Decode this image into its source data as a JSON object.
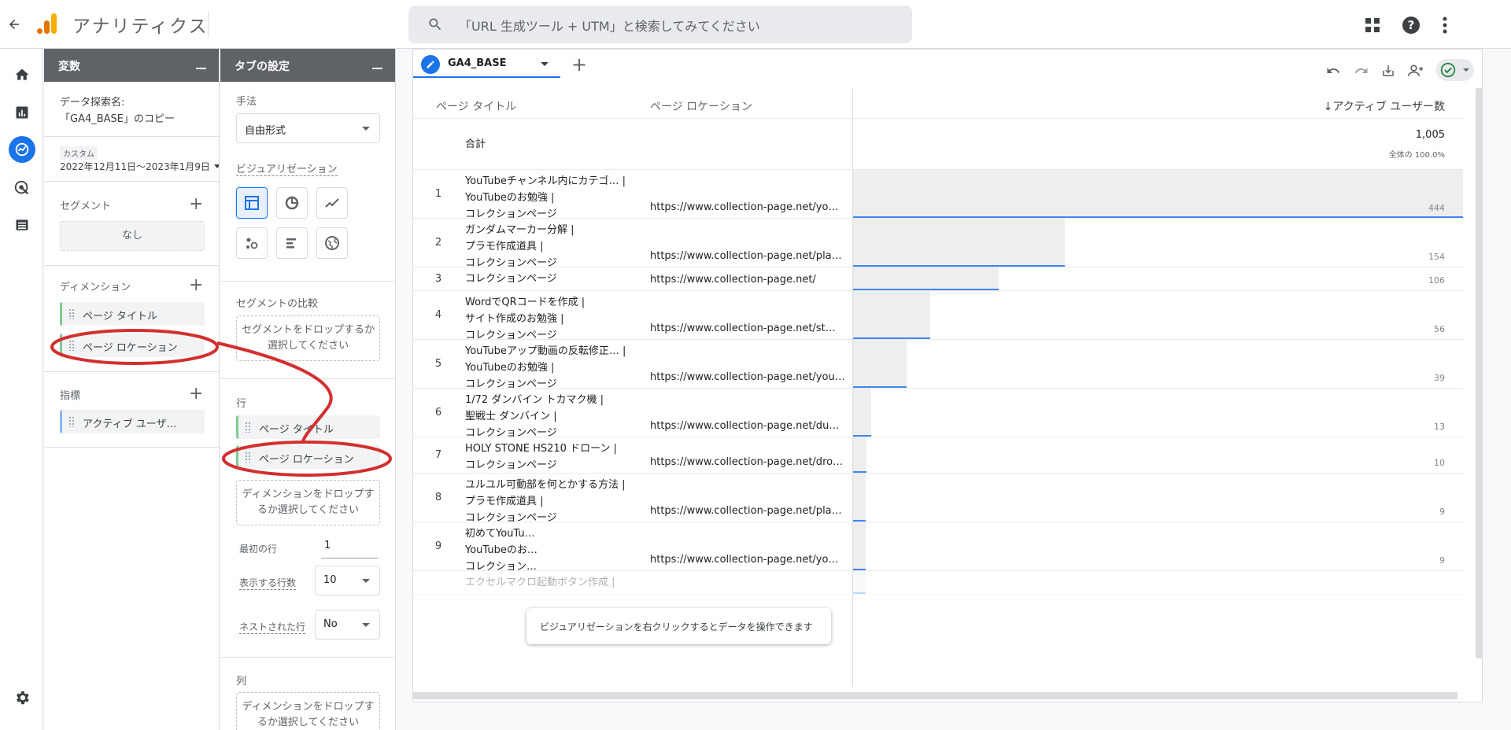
{
  "header": {
    "back_icon": "arrow-left-icon",
    "logo_icon": "analytics-logo-icon",
    "app_title": "アナリティクス",
    "search_placeholder": "「URL 生成ツール + UTM」と検索してみてください",
    "apps_icon": "apps-grid-icon",
    "help_icon": "help-icon",
    "more_icon": "more-vert-icon"
  },
  "nav": {
    "items": [
      "home-icon",
      "reports-icon",
      "explore-icon",
      "advertising-icon",
      "configure-icon"
    ],
    "settings_icon": "gear-icon"
  },
  "variables_panel": {
    "title": "変数",
    "exploration_name_label": "データ探索名:",
    "exploration_name": "「GA4_BASE」のコピー",
    "date_badge": "カスタム",
    "date_range": "2022年12月11日～2023年1月9日",
    "segments_label": "セグメント",
    "segments_empty": "なし",
    "dimensions_label": "ディメンション",
    "dimensions": [
      "ページ タイトル",
      "ページ ロケーション"
    ],
    "metrics_label": "指標",
    "metrics": [
      "アクティブ ユーザ…"
    ]
  },
  "settings_panel": {
    "title": "タブの設定",
    "technique_label": "手法",
    "technique_value": "自由形式",
    "viz_label": "ビジュアリゼーション",
    "viz_icons": [
      "table-icon",
      "donut-chart-icon",
      "line-chart-icon",
      "scatter-chart-icon",
      "bar-chart-icon",
      "geo-map-icon"
    ],
    "segment_compare_label": "セグメントの比較",
    "segment_drop_hint": "セグメントをドロップするか選択してください",
    "rows_label": "行",
    "rows": [
      "ページ タイトル",
      "ページ ロケーション"
    ],
    "dimension_drop_hint": "ディメンションをドロップするか選択してください",
    "first_row_label": "最初の行",
    "first_row_value": "1",
    "show_rows_label": "表示する行数",
    "show_rows_value": "10",
    "nested_rows_label": "ネストされた行",
    "nested_rows_value": "No",
    "columns_label": "列",
    "columns_drop_hint": "ディメンションをドロップするか選択してください"
  },
  "canvas": {
    "tab_name": "GA4_BASE",
    "add_tab": "+",
    "toolbar_icons": [
      "undo-icon",
      "redo-icon",
      "download-icon",
      "share-user-icon",
      "check-status-icon"
    ],
    "col_title": "ページ タイトル",
    "col_location": "ページ ロケーション",
    "col_metric": "↓アクティブ ユーザー数",
    "total_label": "合計",
    "total_value": "1,005",
    "total_pct": "全体の 100.0%",
    "rows": [
      {
        "idx": "1",
        "title": [
          "YouTubeチャンネル内にカテゴ… |",
          "YouTubeのお勉強 |",
          "コレクションページ"
        ],
        "location": "https://www.collection-page.net/yo…",
        "value": "444",
        "ratio": 1.0
      },
      {
        "idx": "2",
        "title": [
          "ガンダムマーカー分解 |",
          "プラモ作成道具 |",
          "コレクションページ"
        ],
        "location": "https://www.collection-page.net/pla…",
        "value": "154",
        "ratio": 0.3468
      },
      {
        "idx": "3",
        "title": [
          "コレクションページ"
        ],
        "location": "https://www.collection-page.net/",
        "value": "106",
        "ratio": 0.2387
      },
      {
        "idx": "4",
        "title": [
          "WordでQRコードを作成 |",
          "サイト作成のお勉強 |",
          "コレクションページ"
        ],
        "location": "https://www.collection-page.net/st…",
        "value": "56",
        "ratio": 0.1261
      },
      {
        "idx": "5",
        "title": [
          "YouTubeアップ動画の反転修正… |",
          "YouTubeのお勉強 |",
          "コレクションページ"
        ],
        "location": "https://www.collection-page.net/you…",
        "value": "39",
        "ratio": 0.0878
      },
      {
        "idx": "6",
        "title": [
          "1/72 ダンバイン トカマク機 |",
          "聖戦士 ダンバイン |",
          "コレクションページ"
        ],
        "location": "https://www.collection-page.net/du…",
        "value": "13",
        "ratio": 0.0293
      },
      {
        "idx": "7",
        "title": [
          "HOLY STONE HS210 ドローン |",
          "コレクションページ"
        ],
        "location": "https://www.collection-page.net/dro…",
        "value": "10",
        "ratio": 0.0225
      },
      {
        "idx": "8",
        "title": [
          "ユルユル可動部を何とかする方法 |",
          "プラモ作成道具 |",
          "コレクションページ"
        ],
        "location": "https://www.collection-page.net/pla…",
        "value": "9",
        "ratio": 0.0203
      },
      {
        "idx": "9",
        "title": [
          "初めてYouTu…",
          "YouTubeのお…",
          "コレクション…"
        ],
        "location": "https://www.collection-page.net/yo…",
        "value": "9",
        "ratio": 0.0203
      },
      {
        "idx": "",
        "title": [
          "エクセルマクロ起動ボタン作成 |"
        ],
        "location": "",
        "value": "",
        "ratio": 0.0203
      }
    ],
    "tooltip": "ビジュアリゼーションを右クリックするとデータを操作できます"
  },
  "colors": {
    "accent": "#1a73e8",
    "bar": "#eeeeee",
    "bar_line": "#4285f4",
    "annotation": "#d32f2f",
    "logo_orange": "#f9ab00",
    "logo_dark": "#e37400"
  }
}
